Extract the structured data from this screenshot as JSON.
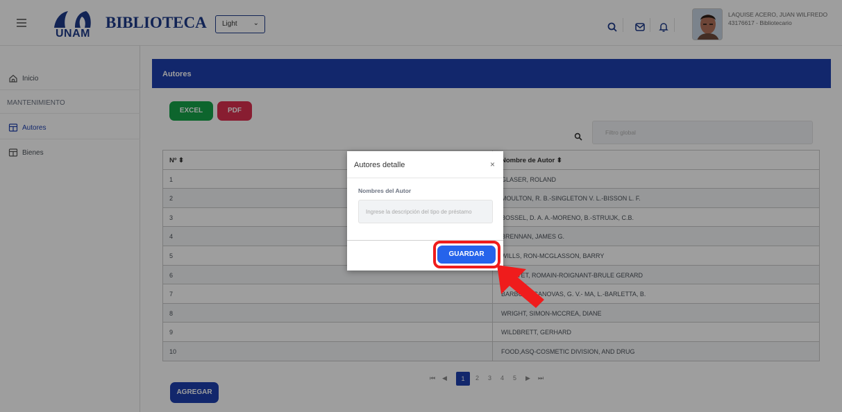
{
  "header": {
    "logo_text": "UNAM",
    "brand": "BIBLIOTECA",
    "theme_select": "Light",
    "user_name": "LAQUISE ACERO, JUAN WILFREDO",
    "user_role": "43176617 - Bibliotecario"
  },
  "sidebar": {
    "items": [
      {
        "label": "Inicio",
        "icon": "home-icon"
      },
      {
        "label": "MANTENIMIENTO"
      },
      {
        "label": "Autores",
        "icon": "table-icon"
      },
      {
        "label": "Bienes",
        "icon": "table-icon"
      }
    ]
  },
  "main": {
    "card_title": "Autores",
    "excel_label": "EXCEL",
    "pdf_label": "PDF",
    "filter_placeholder": "Filtro global",
    "columns": [
      "Nº ⬍",
      "Nombre de Autor ⬍"
    ],
    "rows": [
      {
        "n": "1",
        "name": "GLASER, ROLAND"
      },
      {
        "n": "2",
        "name": "MOULTON, R. B.-SINGLETON V. L.-BISSON L. F."
      },
      {
        "n": "3",
        "name": "BOSSEL, D. A. A.-MORENO, B.-STRUIJK, C.B."
      },
      {
        "n": "4",
        "name": "BRENNAN, JAMES G."
      },
      {
        "n": "5",
        "name": "WILLS, RON-MCGLASSON, BARRY"
      },
      {
        "n": "6",
        "name": "JEANTET, ROMAIN-ROIGNANT-BRULE GERARD"
      },
      {
        "n": "7",
        "name": "BARBOSA-CANOVAS, G. V.- MA, L.-BARLETTA, B."
      },
      {
        "n": "8",
        "name": "WRIGHT, SIMON-MCCREA, DIANE"
      },
      {
        "n": "9",
        "name": "WILDBRETT, GERHARD"
      },
      {
        "n": "10",
        "name": "FOOD,ASQ-COSMETIC DIVISION, AND DRUG"
      }
    ],
    "pager": {
      "first": "⏮",
      "prev": "◀",
      "pages": [
        "1",
        "2",
        "3",
        "4",
        "5"
      ],
      "active": "1",
      "next": "▶",
      "last": "⏭"
    },
    "add_label": "AGREGAR"
  },
  "dialog": {
    "title": "Autores detalle",
    "close": "×",
    "field_label": "Nombres del Autor",
    "field_placeholder": "Ingrese la descripción del tipo de préstamo",
    "save_label": "GUARDAR"
  },
  "colors": {
    "primary": "#1e40af",
    "excel": "#16a34a",
    "pdf": "#dc2f4f",
    "highlight": "#ef1c1c"
  }
}
